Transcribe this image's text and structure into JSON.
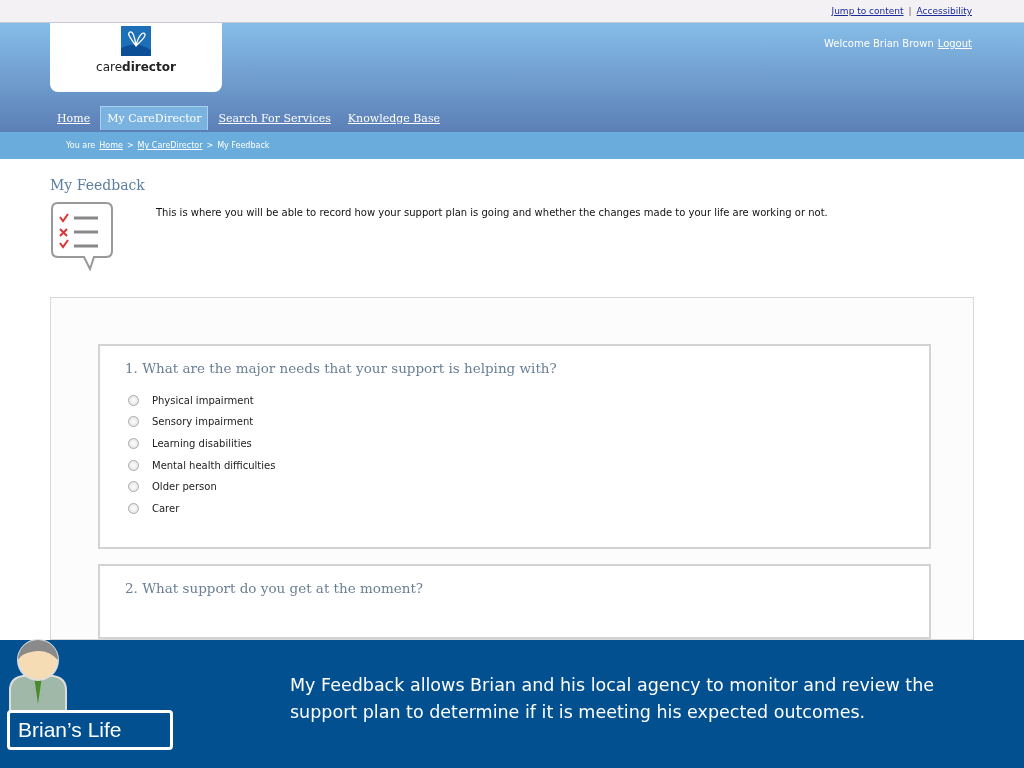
{
  "top_links": [
    {
      "label": "Jump to content"
    },
    {
      "label": "Accessibility"
    }
  ],
  "top_separator": "|",
  "logo": {
    "text_light": "care",
    "text_bold": "director"
  },
  "user": {
    "welcome": "Welcome  Brian Brown",
    "logout": "Logout"
  },
  "tabs": [
    {
      "label": "Home",
      "selected": false
    },
    {
      "label": "My CareDirector",
      "selected": true
    },
    {
      "label": "Search For Services",
      "selected": false
    },
    {
      "label": "Knowledge Base",
      "selected": false
    }
  ],
  "breadcrumb": {
    "prefix": "You are",
    "links": [
      "Home",
      "My CareDirector"
    ],
    "separators": [
      ">",
      ">"
    ],
    "current": "My Feedback"
  },
  "page_title": "My Feedback",
  "intro": "This is where you will be able to record how your support plan is going and whether the changes made to your life are working or not.",
  "questions": [
    {
      "title": "1. What are the major needs that your support is helping with?",
      "options": [
        {
          "label": "Physical impairment",
          "selected": false
        },
        {
          "label": "Sensory impairment",
          "selected": false
        },
        {
          "label": "Learning disabilities",
          "selected": false
        },
        {
          "label": "Mental health difficulties",
          "selected": false
        },
        {
          "label": "Older person",
          "selected": false
        },
        {
          "label": "Carer",
          "selected": false
        }
      ]
    },
    {
      "title": "2. What support do you get at the moment?"
    }
  ],
  "caption": {
    "label": "Brian’s Life",
    "text": "My Feedback allows Brian and his local agency to monitor and review the support plan to determine if it is meeting his expected outcomes."
  }
}
